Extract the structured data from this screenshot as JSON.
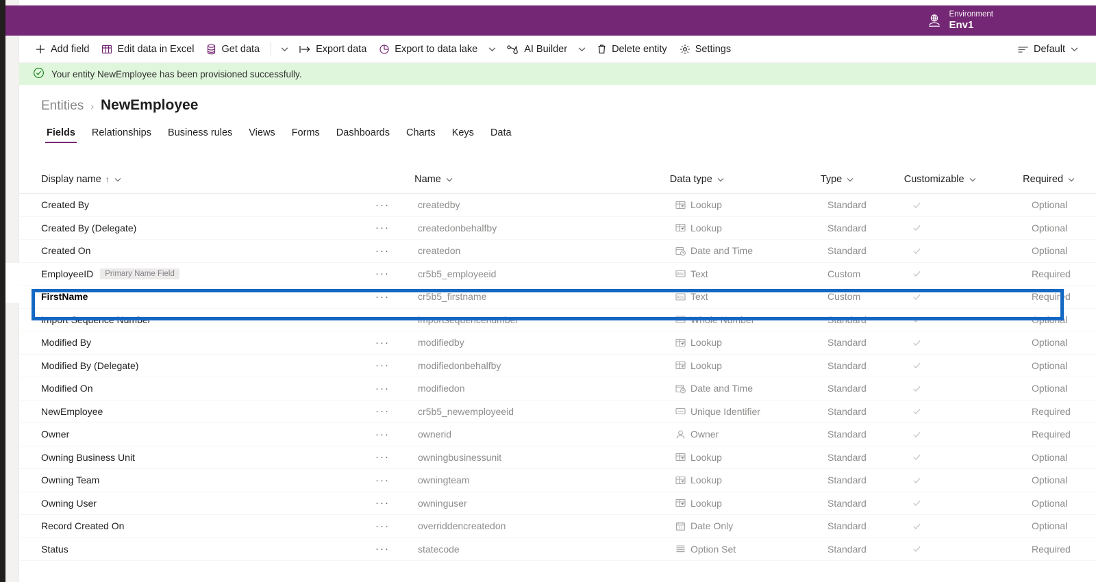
{
  "header": {
    "env_label": "Environment",
    "env_value": "Env1",
    "env_icon": "globe-people-icon"
  },
  "commandbar": {
    "items": [
      {
        "label": "Add field",
        "icon": "plus-icon",
        "caret": false
      },
      {
        "label": "Edit data in Excel",
        "icon": "excel-icon",
        "caret": false
      },
      {
        "label": "Get data",
        "icon": "database-icon",
        "caret": true
      },
      {
        "label": "Export data",
        "icon": "export-icon",
        "caret": false
      },
      {
        "label": "Export to data lake",
        "icon": "datalake-icon",
        "caret": true
      },
      {
        "label": "AI Builder",
        "icon": "ai-builder-icon",
        "caret": true
      },
      {
        "label": "Delete entity",
        "icon": "trash-icon",
        "caret": false
      },
      {
        "label": "Settings",
        "icon": "gear-icon",
        "caret": false
      }
    ],
    "view_selector": {
      "label": "Default",
      "icon": "filter-lines-icon"
    }
  },
  "banner": {
    "icon": "check-circle-icon",
    "message": "Your entity NewEmployee has been provisioned successfully."
  },
  "breadcrumb": {
    "parent": "Entities",
    "separator": "›",
    "current": "NewEmployee"
  },
  "tabs": [
    {
      "label": "Fields",
      "active": true
    },
    {
      "label": "Relationships",
      "active": false
    },
    {
      "label": "Business rules",
      "active": false
    },
    {
      "label": "Views",
      "active": false
    },
    {
      "label": "Forms",
      "active": false
    },
    {
      "label": "Dashboards",
      "active": false
    },
    {
      "label": "Charts",
      "active": false
    },
    {
      "label": "Keys",
      "active": false
    },
    {
      "label": "Data",
      "active": false
    }
  ],
  "grid": {
    "columns": [
      {
        "label": "Display name",
        "sorted": "asc",
        "sort_glyph": "↑"
      },
      {
        "label": "Name",
        "sorted": "none"
      },
      {
        "label": "Data type",
        "sorted": "none"
      },
      {
        "label": "Type",
        "sorted": "none"
      },
      {
        "label": "Customizable",
        "sorted": "none"
      },
      {
        "label": "Required",
        "sorted": "none"
      }
    ],
    "ellipsis_glyph": "···",
    "rows": [
      {
        "display": "Created By",
        "badge": "",
        "name": "createdby",
        "datatype": "Lookup",
        "icon": "lookup-icon",
        "type": "Standard",
        "customizable": true,
        "required": "Optional",
        "highlighted": false
      },
      {
        "display": "Created By (Delegate)",
        "badge": "",
        "name": "createdonbehalfby",
        "datatype": "Lookup",
        "icon": "lookup-icon",
        "type": "Standard",
        "customizable": true,
        "required": "Optional",
        "highlighted": false
      },
      {
        "display": "Created On",
        "badge": "",
        "name": "createdon",
        "datatype": "Date and Time",
        "icon": "datetime-icon",
        "type": "Standard",
        "customizable": true,
        "required": "Optional",
        "highlighted": false
      },
      {
        "display": "EmployeeID",
        "badge": "Primary Name Field",
        "name": "cr5b5_employeeid",
        "datatype": "Text",
        "icon": "text-icon",
        "type": "Custom",
        "customizable": true,
        "required": "Required",
        "highlighted": false
      },
      {
        "display": "FirstName",
        "badge": "",
        "name": "cr5b5_firstname",
        "datatype": "Text",
        "icon": "text-icon",
        "type": "Custom",
        "customizable": true,
        "required": "Required",
        "highlighted": true
      },
      {
        "display": "Import Sequence Number",
        "badge": "",
        "name": "importsequencenumber",
        "datatype": "Whole Number",
        "icon": "number-icon",
        "type": "Standard",
        "customizable": true,
        "required": "Optional",
        "highlighted": false
      },
      {
        "display": "Modified By",
        "badge": "",
        "name": "modifiedby",
        "datatype": "Lookup",
        "icon": "lookup-icon",
        "type": "Standard",
        "customizable": true,
        "required": "Optional",
        "highlighted": false
      },
      {
        "display": "Modified By (Delegate)",
        "badge": "",
        "name": "modifiedonbehalfby",
        "datatype": "Lookup",
        "icon": "lookup-icon",
        "type": "Standard",
        "customizable": true,
        "required": "Optional",
        "highlighted": false
      },
      {
        "display": "Modified On",
        "badge": "",
        "name": "modifiedon",
        "datatype": "Date and Time",
        "icon": "datetime-icon",
        "type": "Standard",
        "customizable": true,
        "required": "Optional",
        "highlighted": false
      },
      {
        "display": "NewEmployee",
        "badge": "",
        "name": "cr5b5_newemployeeid",
        "datatype": "Unique Identifier",
        "icon": "uniqueid-icon",
        "type": "Standard",
        "customizable": true,
        "required": "Required",
        "highlighted": false
      },
      {
        "display": "Owner",
        "badge": "",
        "name": "ownerid",
        "datatype": "Owner",
        "icon": "person-icon",
        "type": "Standard",
        "customizable": true,
        "required": "Required",
        "highlighted": false
      },
      {
        "display": "Owning Business Unit",
        "badge": "",
        "name": "owningbusinessunit",
        "datatype": "Lookup",
        "icon": "lookup-icon",
        "type": "Standard",
        "customizable": true,
        "required": "Optional",
        "highlighted": false
      },
      {
        "display": "Owning Team",
        "badge": "",
        "name": "owningteam",
        "datatype": "Lookup",
        "icon": "lookup-icon",
        "type": "Standard",
        "customizable": true,
        "required": "Optional",
        "highlighted": false
      },
      {
        "display": "Owning User",
        "badge": "",
        "name": "owninguser",
        "datatype": "Lookup",
        "icon": "lookup-icon",
        "type": "Standard",
        "customizable": true,
        "required": "Optional",
        "highlighted": false
      },
      {
        "display": "Record Created On",
        "badge": "",
        "name": "overriddencreatedon",
        "datatype": "Date Only",
        "icon": "dateonly-icon",
        "type": "Standard",
        "customizable": true,
        "required": "Optional",
        "highlighted": false
      },
      {
        "display": "Status",
        "badge": "",
        "name": "statecode",
        "datatype": "Option Set",
        "icon": "optionset-icon",
        "type": "Standard",
        "customizable": true,
        "required": "Required",
        "highlighted": false
      }
    ]
  },
  "colors": {
    "brand_purple": "#742774",
    "banner_green": "#dff6dd",
    "highlight_blue": "#1268c3"
  }
}
